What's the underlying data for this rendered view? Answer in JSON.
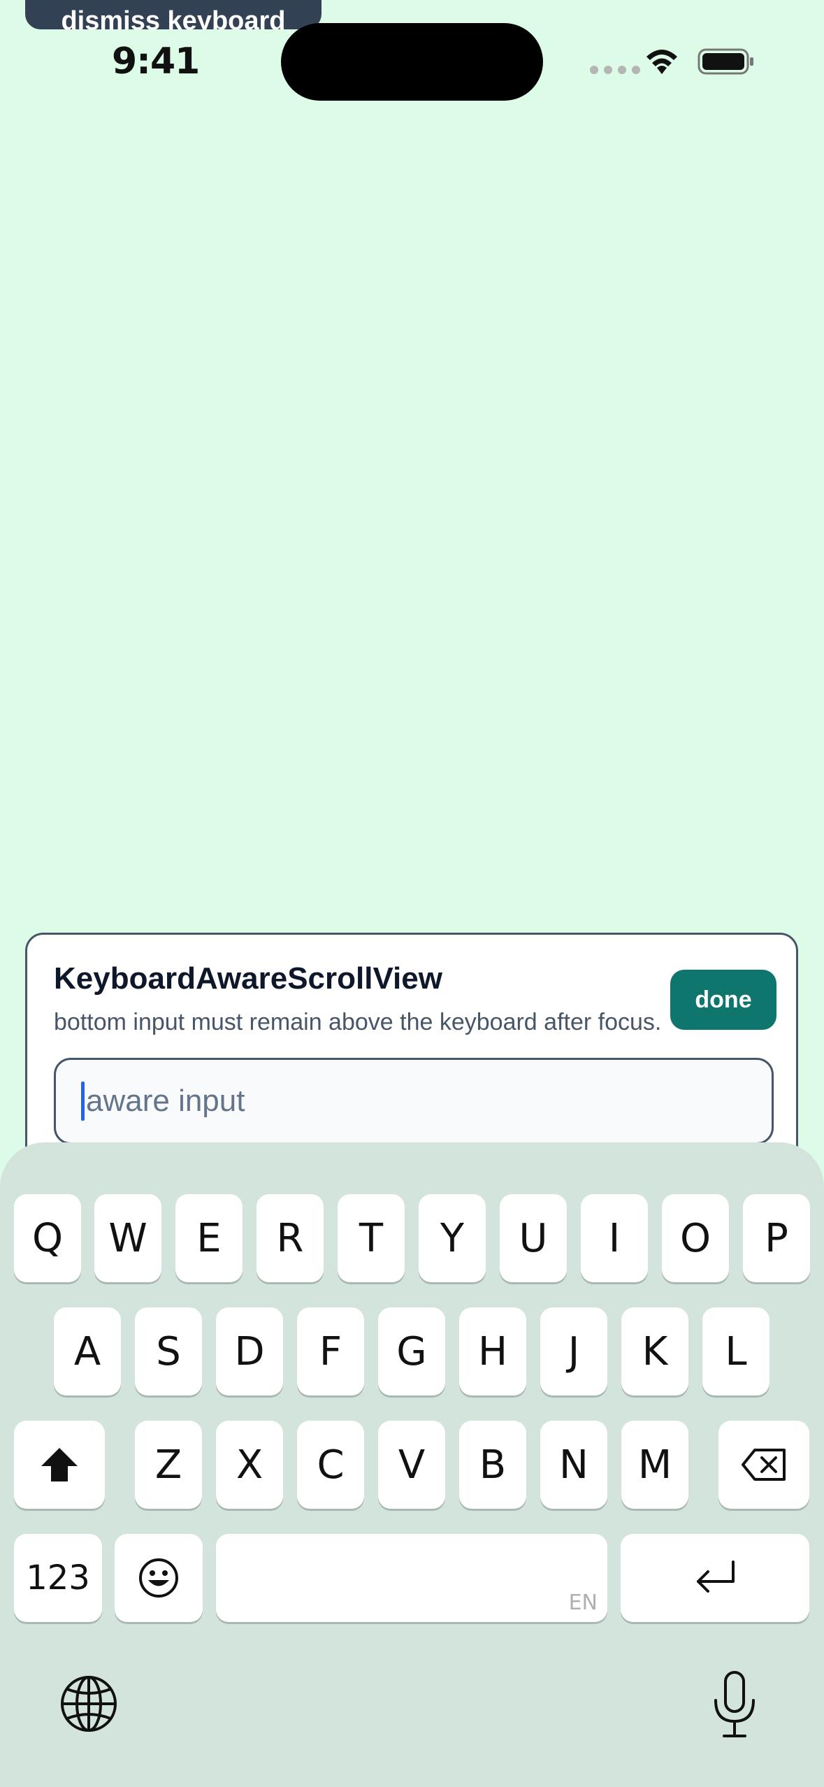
{
  "top_banner": {
    "label": "dismiss keyboard"
  },
  "status_bar": {
    "time": "9:41"
  },
  "card": {
    "title": "KeyboardAwareScrollView",
    "subtitle": "bottom input must remain above the keyboard after focus.",
    "done_label": "done",
    "input": {
      "placeholder": "aware input",
      "value": ""
    }
  },
  "keyboard": {
    "row1": [
      "Q",
      "W",
      "E",
      "R",
      "T",
      "Y",
      "U",
      "I",
      "O",
      "P"
    ],
    "row2": [
      "A",
      "S",
      "D",
      "F",
      "G",
      "H",
      "J",
      "K",
      "L"
    ],
    "row3": [
      "Z",
      "X",
      "C",
      "V",
      "B",
      "N",
      "M"
    ],
    "numbers_label": "123",
    "space_lang": "EN"
  },
  "colors": {
    "background": "#dcfce7",
    "accent": "#0f766e",
    "caret": "#2563eb",
    "keyboard_bg": "#d3e4dc"
  }
}
